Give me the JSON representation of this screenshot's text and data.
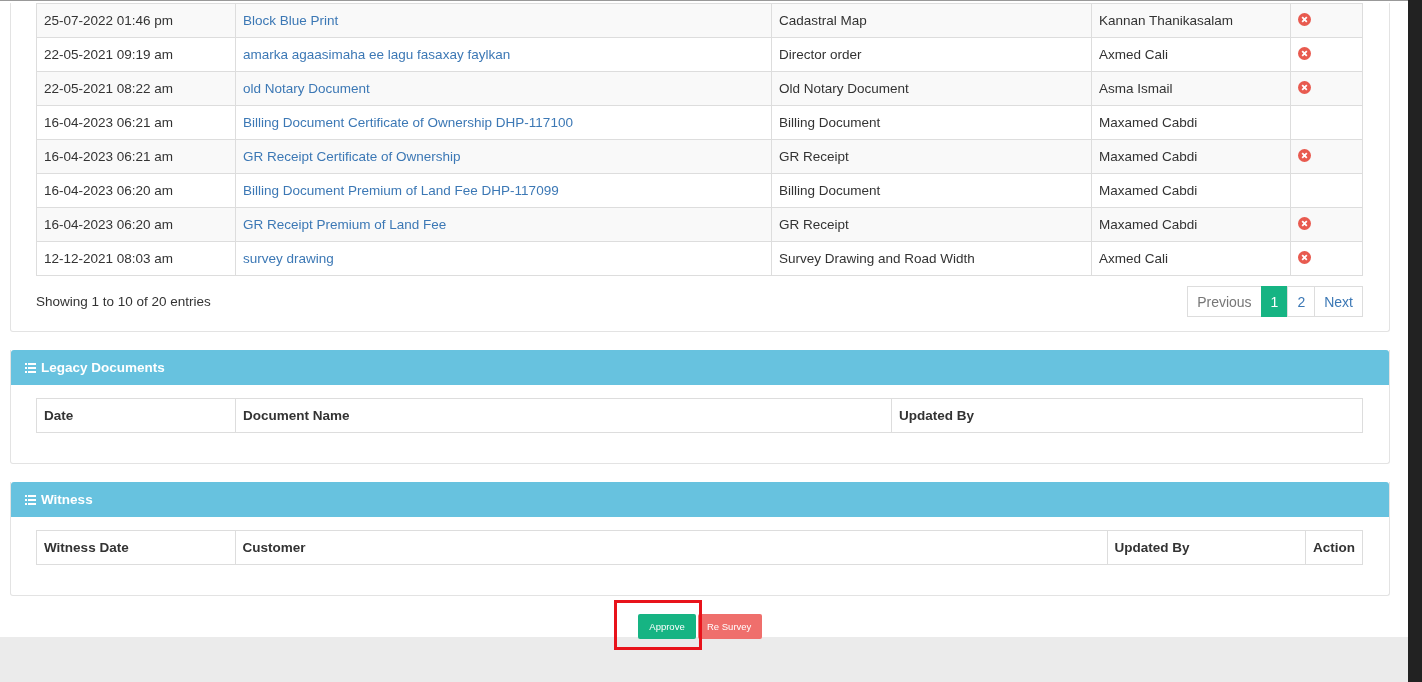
{
  "documents": {
    "rows": [
      {
        "date": "25-07-2022 01:46 pm",
        "name": "Block Blue Print",
        "type": "Cadastral Map",
        "updated_by": "Kannan Thanikasalam",
        "removable": true
      },
      {
        "date": "22-05-2021 09:19 am",
        "name": "amarka agaasimaha ee lagu fasaxay faylkan",
        "type": "Director order",
        "updated_by": "Axmed Cali",
        "removable": true
      },
      {
        "date": "22-05-2021 08:22 am",
        "name": "old Notary Document",
        "type": "Old Notary Document",
        "updated_by": "Asma Ismail",
        "removable": true
      },
      {
        "date": "16-04-2023 06:21 am",
        "name": "Billing Document Certificate of Ownership DHP-117100",
        "type": "Billing Document",
        "updated_by": "Maxamed Cabdi",
        "removable": false
      },
      {
        "date": "16-04-2023 06:21 am",
        "name": "GR Receipt Certificate of Ownership",
        "type": "GR Receipt",
        "updated_by": "Maxamed Cabdi",
        "removable": true
      },
      {
        "date": "16-04-2023 06:20 am",
        "name": "Billing Document Premium of Land Fee DHP-117099",
        "type": "Billing Document",
        "updated_by": "Maxamed Cabdi",
        "removable": false
      },
      {
        "date": "16-04-2023 06:20 am",
        "name": "GR Receipt Premium of Land Fee",
        "type": "GR Receipt",
        "updated_by": "Maxamed Cabdi",
        "removable": true
      },
      {
        "date": "12-12-2021 08:03 am",
        "name": "survey drawing",
        "type": "Survey Drawing and Road Width",
        "updated_by": "Axmed Cali",
        "removable": true
      }
    ],
    "info": "Showing 1 to 10 of 20 entries",
    "pagination": [
      {
        "label": "Previous",
        "selected": false
      },
      {
        "label": "1",
        "selected": true
      },
      {
        "label": "2",
        "selected": false
      },
      {
        "label": "Next",
        "selected": false
      }
    ]
  },
  "legacy_documents": {
    "title": "Legacy Documents",
    "columns": [
      "Date",
      "Document Name",
      "Updated By"
    ]
  },
  "witness": {
    "title": "Witness",
    "columns": [
      "Witness Date",
      "Customer",
      "Updated By",
      "Action"
    ]
  },
  "actions": [
    {
      "label": "Approve",
      "kind": "approve"
    },
    {
      "label": "Re Survey",
      "kind": "resurvey"
    }
  ]
}
